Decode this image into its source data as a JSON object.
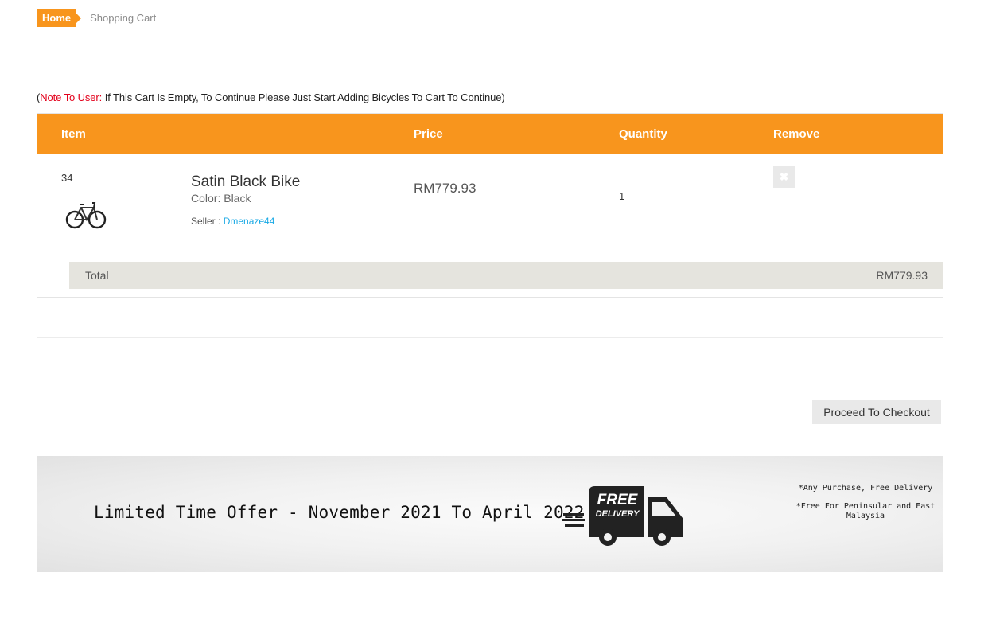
{
  "breadcrumb": {
    "home": "Home",
    "current": "Shopping Cart"
  },
  "note": {
    "open_paren": "(",
    "label": "Note To User:",
    "text": " If This Cart Is Empty, To Continue Please Just Start Adding Bicycles To Cart To Continue)"
  },
  "cart": {
    "headers": {
      "item": "Item",
      "price": "Price",
      "quantity": "Quantity",
      "remove": "Remove"
    },
    "rows": [
      {
        "id": "34",
        "name": "Satin Black Bike",
        "color_label": "Color: ",
        "color": "Black",
        "seller_label": "Seller : ",
        "seller": "Dmenaze44",
        "price": "RM779.93",
        "quantity": "1",
        "remove_icon": "close-icon"
      }
    ],
    "total_label": "Total",
    "total_value": "RM779.93"
  },
  "checkout": {
    "label": "Proceed To Checkout"
  },
  "banner": {
    "title": "Limited Time Offer - November 2021 To April 2022",
    "truck_text1": "FREE",
    "truck_text2": "DELIVERY",
    "note1": "*Any Purchase, Free Delivery",
    "note2": "*Free For Peninsular and East Malaysia"
  },
  "colors": {
    "accent": "#f8951d",
    "link": "#19a9e5",
    "note_red": "#e3001b",
    "total_bg": "#e5e4de"
  }
}
